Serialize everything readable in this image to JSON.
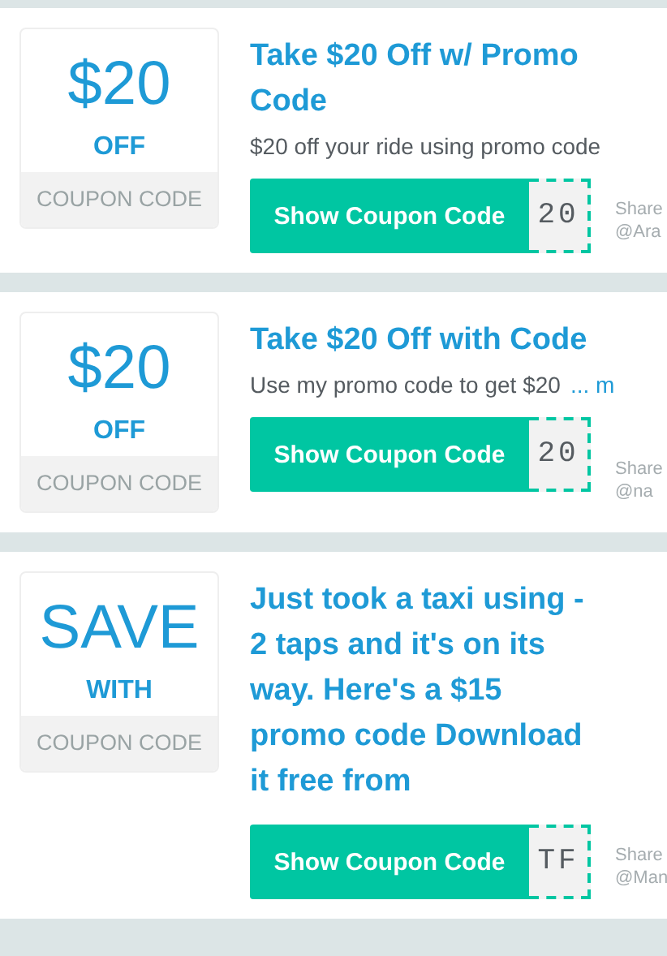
{
  "coupons": [
    {
      "badge": {
        "amount": "$20",
        "unit": "OFF",
        "label": "COUPON CODE"
      },
      "title": "Take $20 Off w/ Promo Code",
      "description": "$20 off your ride using promo code",
      "button": "Show Coupon Code",
      "code_peek": "20",
      "shared_by": [
        "Share",
        "@Ara"
      ]
    },
    {
      "badge": {
        "amount": "$20",
        "unit": "OFF",
        "label": "COUPON CODE"
      },
      "title": "Take $20 Off with Code",
      "description": "Use my promo code to get $20",
      "more_link": "... m",
      "button": "Show Coupon Code",
      "code_peek": "20",
      "shared_by": [
        "Share",
        "@na"
      ]
    },
    {
      "badge": {
        "amount": "SAVE",
        "unit": "WITH",
        "label": "COUPON CODE"
      },
      "title": "Just took a taxi using - 2 taps and it's on its way. Here's a $15 promo code Download it free from",
      "button": "Show Coupon Code",
      "code_peek": "TF",
      "shared_by": [
        "Share",
        "@Man"
      ]
    }
  ]
}
